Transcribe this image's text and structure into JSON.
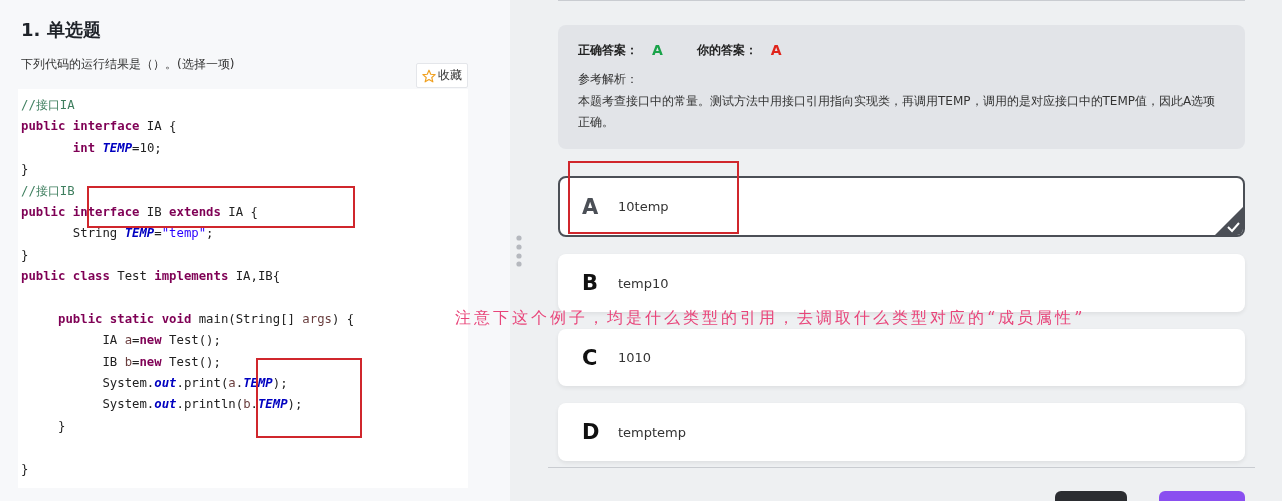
{
  "question": {
    "title": "1. 单选题",
    "prompt": "下列代码的运行结果是（）。(选择一项)",
    "favorite_button": "收藏",
    "code": [
      {
        "tokens": [
          {
            "kind": "comment",
            "text": "//接口IA"
          }
        ]
      },
      {
        "tokens": [
          {
            "kind": "keyword",
            "text": "public"
          },
          {
            "kind": "keyword",
            "text": " interface"
          },
          {
            "kind": "plain",
            "text": " IA {"
          }
        ]
      },
      {
        "tokens": [
          {
            "kind": "keyword",
            "text": "       int"
          },
          {
            "kind": "field",
            "text": " TEMP"
          },
          {
            "kind": "plain",
            "text": "=10;"
          }
        ]
      },
      {
        "tokens": [
          {
            "kind": "plain",
            "text": "}"
          }
        ]
      },
      {
        "tokens": [
          {
            "kind": "comment",
            "text": "//接口IB"
          }
        ]
      },
      {
        "tokens": [
          {
            "kind": "keyword",
            "text": "public"
          },
          {
            "kind": "keyword",
            "text": " interface"
          },
          {
            "kind": "plain",
            "text": " IB "
          },
          {
            "kind": "keyword",
            "text": "extends"
          },
          {
            "kind": "plain",
            "text": " IA {"
          }
        ]
      },
      {
        "tokens": [
          {
            "kind": "plain",
            "text": "       String "
          },
          {
            "kind": "field",
            "text": "TEMP"
          },
          {
            "kind": "plain",
            "text": "="
          },
          {
            "kind": "string",
            "text": "\"temp\""
          },
          {
            "kind": "plain",
            "text": ";"
          }
        ]
      },
      {
        "tokens": [
          {
            "kind": "plain",
            "text": "}"
          }
        ]
      },
      {
        "tokens": [
          {
            "kind": "keyword",
            "text": "public"
          },
          {
            "kind": "keyword",
            "text": " class"
          },
          {
            "kind": "plain",
            "text": " Test "
          },
          {
            "kind": "keyword",
            "text": "implements"
          },
          {
            "kind": "plain",
            "text": " IA,IB{"
          }
        ]
      },
      {
        "kind": "blank"
      },
      {
        "tokens": [
          {
            "kind": "keyword",
            "text": "     public"
          },
          {
            "kind": "keyword",
            "text": " static"
          },
          {
            "kind": "keyword",
            "text": " void"
          },
          {
            "kind": "plain",
            "text": " main(String[] "
          },
          {
            "kind": "local",
            "text": "args"
          },
          {
            "kind": "plain",
            "text": ") {"
          }
        ]
      },
      {
        "tokens": [
          {
            "kind": "plain",
            "text": "           IA "
          },
          {
            "kind": "local",
            "text": "a"
          },
          {
            "kind": "plain",
            "text": "="
          },
          {
            "kind": "keyword",
            "text": "new"
          },
          {
            "kind": "plain",
            "text": " Test();"
          }
        ]
      },
      {
        "tokens": [
          {
            "kind": "plain",
            "text": "           IB "
          },
          {
            "kind": "local",
            "text": "b"
          },
          {
            "kind": "plain",
            "text": "="
          },
          {
            "kind": "keyword",
            "text": "new"
          },
          {
            "kind": "plain",
            "text": " Test();"
          }
        ]
      },
      {
        "tokens": [
          {
            "kind": "plain",
            "text": "           System."
          },
          {
            "kind": "field",
            "text": "out"
          },
          {
            "kind": "plain",
            "text": ".print("
          },
          {
            "kind": "local",
            "text": "a"
          },
          {
            "kind": "plain",
            "text": "."
          },
          {
            "kind": "field",
            "text": "TEMP"
          },
          {
            "kind": "plain",
            "text": ");"
          }
        ]
      },
      {
        "tokens": [
          {
            "kind": "plain",
            "text": "           System."
          },
          {
            "kind": "field",
            "text": "out"
          },
          {
            "kind": "plain",
            "text": ".println("
          },
          {
            "kind": "local",
            "text": "b"
          },
          {
            "kind": "plain",
            "text": "."
          },
          {
            "kind": "field",
            "text": "TEMP"
          },
          {
            "kind": "plain",
            "text": ");"
          }
        ]
      },
      {
        "tokens": [
          {
            "kind": "plain",
            "text": "     }"
          }
        ]
      },
      {
        "kind": "blank"
      },
      {
        "tokens": [
          {
            "kind": "plain",
            "text": "}"
          }
        ]
      }
    ]
  },
  "answer": {
    "correct_label": "正确答案：",
    "correct": "A",
    "yours_label": "你的答案：",
    "yours": "A",
    "analysis_label": "参考解析：",
    "analysis": "本题考查接口中的常量。测试方法中用接口引用指向实现类，再调用TEMP，调用的是对应接口中的TEMP值，因此A选项正确。"
  },
  "options": [
    {
      "letter": "A",
      "text": "10temp",
      "selected": true
    },
    {
      "letter": "B",
      "text": "temp10",
      "selected": false
    },
    {
      "letter": "C",
      "text": "1010",
      "selected": false
    },
    {
      "letter": "D",
      "text": "temptemp",
      "selected": false
    }
  ],
  "annotation": {
    "note": "注意下这个例子，均是什么类型的引用，去调取什么类型对应的“成员属性”"
  }
}
